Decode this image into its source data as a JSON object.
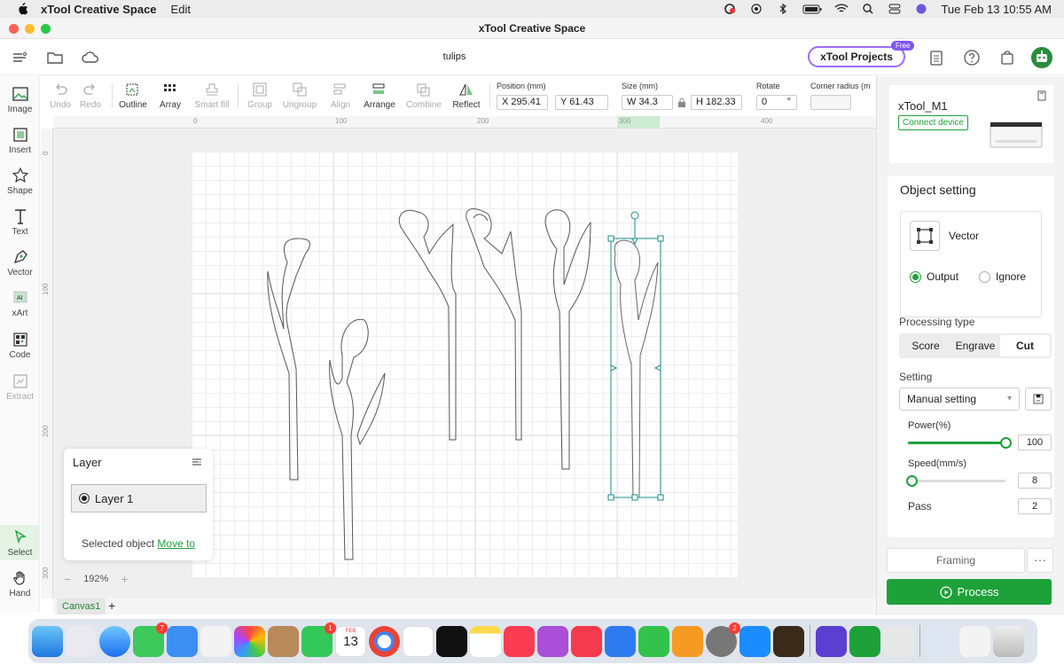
{
  "menubar": {
    "app_name": "xTool Creative Space",
    "menus": [
      "Edit"
    ],
    "datetime": "Tue Feb 13  10:55 AM"
  },
  "window": {
    "title": "xTool Creative Space"
  },
  "topbar": {
    "file_name": "tulips",
    "projects_label": "xTool Projects",
    "free_badge": "Free"
  },
  "sidebar": {
    "tools": [
      {
        "label": "Image"
      },
      {
        "label": "Insert"
      },
      {
        "label": "Shape"
      },
      {
        "label": "Text"
      },
      {
        "label": "Vector"
      },
      {
        "label": "xArt"
      },
      {
        "label": "Code"
      },
      {
        "label": "Extract"
      },
      {
        "label": "Select"
      },
      {
        "label": "Hand"
      }
    ]
  },
  "toolbar": {
    "undo": "Undo",
    "redo": "Redo",
    "outline": "Outline",
    "array": "Array",
    "smart_fill": "Smart fill",
    "group": "Group",
    "ungroup": "Ungroup",
    "align": "Align",
    "arrange": "Arrange",
    "combine": "Combine",
    "reflect": "Reflect",
    "position_label": "Position (mm)",
    "pos_x": "X 295.41",
    "pos_y": "Y 61.43",
    "size_label": "Size (mm)",
    "size_w": "W 34.3",
    "size_h": "H 182.33",
    "rotate_label": "Rotate",
    "rotate_value": "0",
    "rotate_unit": "°",
    "corner_label": "Corner radius (m"
  },
  "rulers": {
    "top": [
      "0",
      "100",
      "200",
      "300",
      "400"
    ],
    "left": [
      "0",
      "100",
      "200",
      "300"
    ]
  },
  "layer_panel": {
    "title": "Layer",
    "layer_name": "Layer 1",
    "selected_text": "Selected object",
    "move_to": "Move to"
  },
  "zoom": {
    "minus": "−",
    "value": "192%",
    "plus": "+"
  },
  "canvas_tabs": {
    "active": "Canvas1",
    "add": "+"
  },
  "right_panel": {
    "device_name": "xTool_M1",
    "connect_label": "Connect device",
    "object_setting_title": "Object setting",
    "vector_label": "Vector",
    "output_label": "Output",
    "ignore_label": "Ignore",
    "processing_type_label": "Processing type",
    "processing_types": [
      "Score",
      "Engrave",
      "Cut"
    ],
    "setting_label": "Setting",
    "setting_value": "Manual setting",
    "power_label": "Power(%)",
    "power_value": "100",
    "speed_label": "Speed(mm/s)",
    "speed_value": "8",
    "pass_label": "Pass",
    "pass_value": "2",
    "framing_label": "Framing",
    "more_label": "···",
    "process_label": "Process",
    "power_fraction": 1.0,
    "speed_fraction": 0.04
  },
  "dock": {
    "badges": {
      "messages": "7",
      "facetime": "1",
      "calendar_month": "FEB",
      "calendar_day": "13",
      "settings": "2"
    }
  },
  "colors": {
    "accent": "#1fa13a",
    "selection": "#1b8c8c"
  }
}
